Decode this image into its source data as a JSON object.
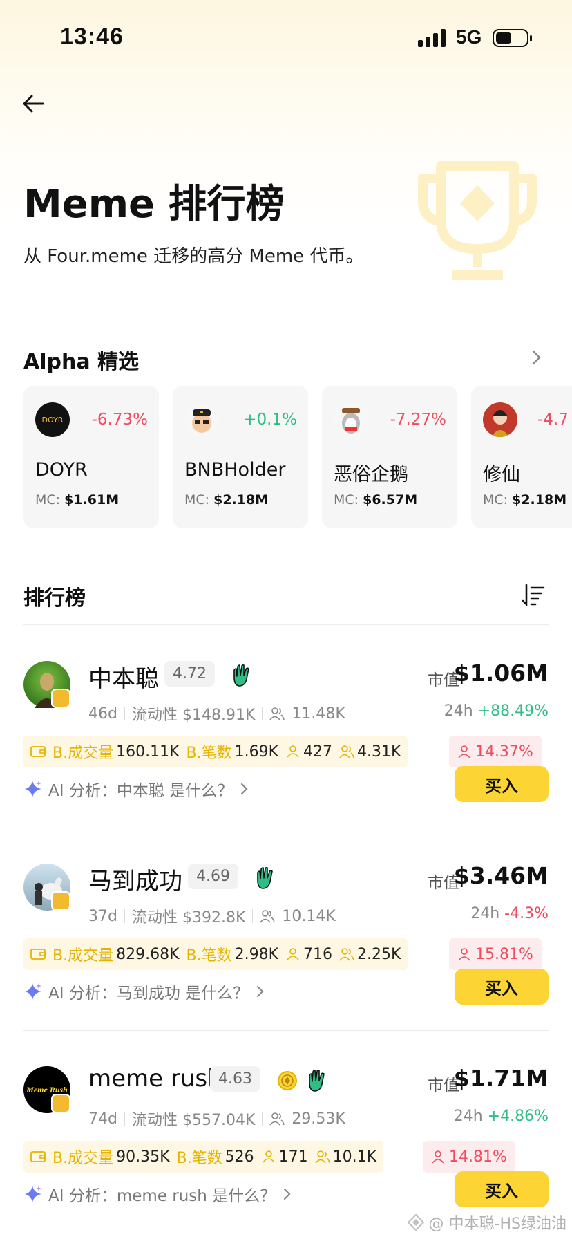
{
  "status": {
    "time": "13:46",
    "network": "5G"
  },
  "hero": {
    "title": "Meme 排行榜",
    "subtitle": "从 Four.meme 迁移的高分 Meme 代币。"
  },
  "alpha": {
    "heading": "Alpha 精选",
    "cards": [
      {
        "name": "DOYR",
        "change": "-6.73%",
        "direction": "down",
        "mc_label": "MC:",
        "mc": "$1.61M",
        "avatar_text": "DOYR"
      },
      {
        "name": "BNBHolder",
        "change": "+0.1%",
        "direction": "up",
        "mc_label": "MC:",
        "mc": "$2.18M"
      },
      {
        "name": "恶俗企鹅",
        "change": "-7.27%",
        "direction": "down",
        "mc_label": "MC:",
        "mc": "$6.57M"
      },
      {
        "name": "修仙",
        "change": "-4.7",
        "direction": "down",
        "mc_label": "MC:",
        "mc": "$2.18M"
      }
    ]
  },
  "ranking": {
    "heading": "排行榜",
    "rows": [
      {
        "name": "中本聪",
        "score": "4.72",
        "age": "46d",
        "liquidity": "流动性 $148.91K",
        "holders": "11.48K",
        "mcap_label": "市值",
        "mcap": "$1.06M",
        "change_label": "24h",
        "change": "+88.49%",
        "direction": "up",
        "volume_label": "B.成交量",
        "volume": "160.11K",
        "txns_label": "B.笔数",
        "txns": "1.69K",
        "traders": "427",
        "buyers": "4.31K",
        "top_holders": "14.37%",
        "ai_text": "AI 分析：中本聪 是什么？",
        "buy_label": "买入"
      },
      {
        "name": "马到成功",
        "score": "4.69",
        "age": "37d",
        "liquidity": "流动性 $392.8K",
        "holders": "10.14K",
        "mcap_label": "市值",
        "mcap": "$3.46M",
        "change_label": "24h",
        "change": "-4.3%",
        "direction": "down",
        "volume_label": "B.成交量",
        "volume": "829.68K",
        "txns_label": "B.笔数",
        "txns": "2.98K",
        "traders": "716",
        "buyers": "2.25K",
        "top_holders": "15.81%",
        "ai_text": "AI 分析：马到成功 是什么？",
        "buy_label": "买入"
      },
      {
        "name": "meme rush",
        "score": "4.63",
        "age": "74d",
        "liquidity": "流动性 $557.04K",
        "holders": "29.53K",
        "mcap_label": "市值",
        "mcap": "$1.71M",
        "change_label": "24h",
        "change": "+4.86%",
        "direction": "up",
        "volume_label": "B.成交量",
        "volume": "90.35K",
        "txns_label": "B.笔数",
        "txns": "526",
        "traders": "171",
        "buyers": "10.1K",
        "top_holders": "14.81%",
        "ai_text": "AI 分析：meme rush 是什么？",
        "buy_label": "买入",
        "avatar_text": "Meme Rush"
      }
    ]
  },
  "watermark": "@ 中本聪-HS绿油油",
  "colors": {
    "up": "#2ebd85",
    "down": "#f04b5e",
    "accent": "#fcd535"
  }
}
